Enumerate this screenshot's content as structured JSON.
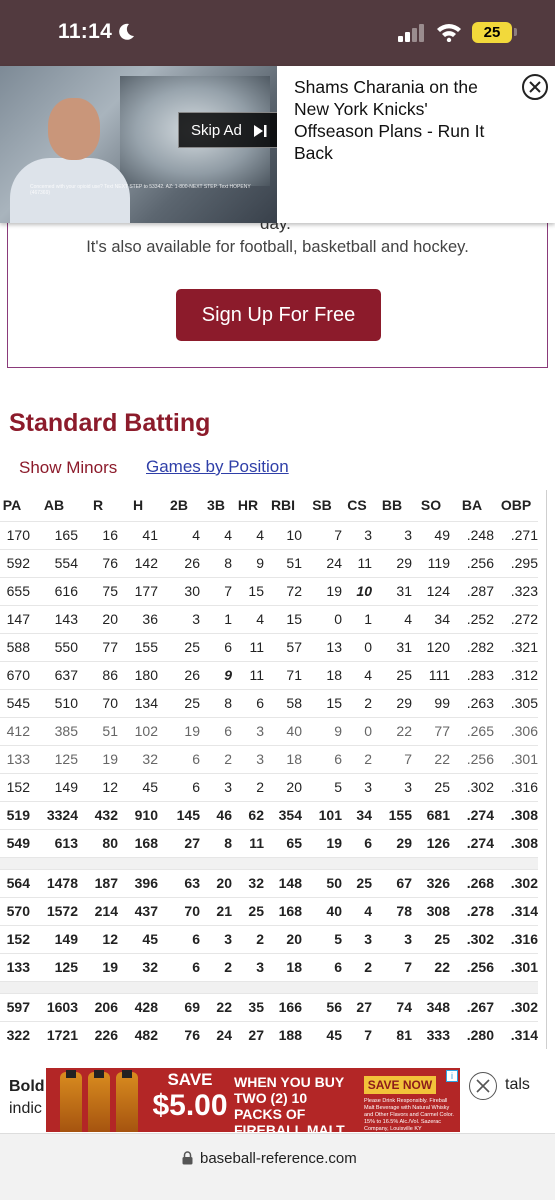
{
  "status_bar": {
    "time": "11:14",
    "battery": "25"
  },
  "video_ad": {
    "skip_label": "Skip Ad",
    "headline": "Shams Charania on the New York Knicks' Offseason Plans - Run It Back",
    "fine_print": "Concerned with your opioid use? Text NEXT STEP to 53342. AZ: 1-800-NEXT STEP. Text HOPENY (467369)"
  },
  "signup": {
    "partial_text": "day.",
    "text": "It's also available for football, basketball and hockey.",
    "button_label": "Sign Up For Free"
  },
  "section": {
    "title": "Standard Batting",
    "show_minors": "Show Minors",
    "games_by_position": "Games by Position"
  },
  "table": {
    "headers": [
      "PA",
      "AB",
      "R",
      "H",
      "2B",
      "3B",
      "HR",
      "RBI",
      "SB",
      "CS",
      "BB",
      "SO",
      "BA",
      "OBP"
    ],
    "rows": [
      [
        "170",
        "165",
        "16",
        "41",
        "4",
        "4",
        "4",
        "10",
        "7",
        "3",
        "3",
        "49",
        ".248",
        ".271"
      ],
      [
        "592",
        "554",
        "76",
        "142",
        "26",
        "8",
        "9",
        "51",
        "24",
        "11",
        "29",
        "119",
        ".256",
        ".295"
      ],
      [
        "655",
        "616",
        "75",
        "177",
        "30",
        "7",
        "15",
        "72",
        "19",
        "10",
        "31",
        "124",
        ".287",
        ".323"
      ],
      [
        "147",
        "143",
        "20",
        "36",
        "3",
        "1",
        "4",
        "15",
        "0",
        "1",
        "4",
        "34",
        ".252",
        ".272"
      ],
      [
        "588",
        "550",
        "77",
        "155",
        "25",
        "6",
        "11",
        "57",
        "13",
        "0",
        "31",
        "120",
        ".282",
        ".321"
      ],
      [
        "670",
        "637",
        "86",
        "180",
        "26",
        "9",
        "11",
        "71",
        "18",
        "4",
        "25",
        "111",
        ".283",
        ".312"
      ],
      [
        "545",
        "510",
        "70",
        "134",
        "25",
        "8",
        "6",
        "58",
        "15",
        "2",
        "29",
        "99",
        ".263",
        ".305"
      ],
      [
        "412",
        "385",
        "51",
        "102",
        "19",
        "6",
        "3",
        "40",
        "9",
        "0",
        "22",
        "77",
        ".265",
        ".306"
      ],
      [
        "133",
        "125",
        "19",
        "32",
        "6",
        "2",
        "3",
        "18",
        "6",
        "2",
        "7",
        "22",
        ".256",
        ".301"
      ],
      [
        "152",
        "149",
        "12",
        "45",
        "6",
        "3",
        "2",
        "20",
        "5",
        "3",
        "3",
        "25",
        ".302",
        ".316"
      ],
      [
        "519",
        "3324",
        "432",
        "910",
        "145",
        "46",
        "62",
        "354",
        "101",
        "34",
        "155",
        "681",
        ".274",
        ".308"
      ],
      [
        "549",
        "613",
        "80",
        "168",
        "27",
        "8",
        "11",
        "65",
        "19",
        "6",
        "29",
        "126",
        ".274",
        ".308"
      ],
      [
        "564",
        "1478",
        "187",
        "396",
        "63",
        "20",
        "32",
        "148",
        "50",
        "25",
        "67",
        "326",
        ".268",
        ".302"
      ],
      [
        "570",
        "1572",
        "214",
        "437",
        "70",
        "21",
        "25",
        "168",
        "40",
        "4",
        "78",
        "308",
        ".278",
        ".314"
      ],
      [
        "152",
        "149",
        "12",
        "45",
        "6",
        "3",
        "2",
        "20",
        "5",
        "3",
        "3",
        "25",
        ".302",
        ".316"
      ],
      [
        "133",
        "125",
        "19",
        "32",
        "6",
        "2",
        "3",
        "18",
        "6",
        "2",
        "7",
        "22",
        ".256",
        ".301"
      ],
      [
        "597",
        "1603",
        "206",
        "428",
        "69",
        "22",
        "35",
        "166",
        "56",
        "27",
        "74",
        "348",
        ".267",
        ".302"
      ],
      [
        "322",
        "1721",
        "226",
        "482",
        "76",
        "24",
        "27",
        "188",
        "45",
        "7",
        "81",
        "333",
        ".280",
        ".314"
      ]
    ]
  },
  "footer_note": {
    "bold": "Bold",
    "rest": "indic",
    "tail": "tals"
  },
  "banner_ad": {
    "save_top": "SAVE",
    "save_amount": "$5.00",
    "offer": "WHEN YOU BUY TWO (2) 10 PACKS OF FIREBALL MALT",
    "save_now": "SAVE NOW",
    "small_print": "Please Drink Responsibly. Fireball Malt Beverage with Natural Whisky and Other Flavors and Carmel Color. 15% to 16.5% Alc./Vol. Sazerac Company, Louisville KY"
  },
  "url_bar": {
    "url": "baseball-reference.com"
  },
  "colors": {
    "status_bar": "#523a3f",
    "brand_red": "#8c1b2b",
    "link_blue": "#2f3fa8",
    "battery": "#f2d93b"
  }
}
